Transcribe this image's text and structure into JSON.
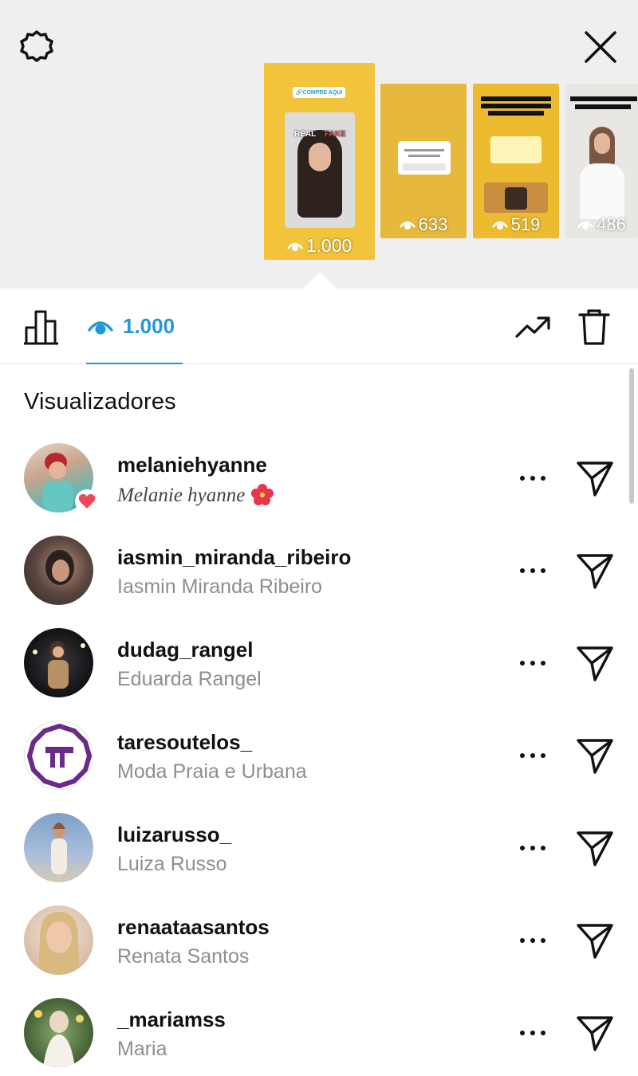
{
  "header": {
    "settings_icon": "gear-icon",
    "close_icon": "close-icon"
  },
  "stories": [
    {
      "views": "1.000",
      "selected": true,
      "tag_text": "COMPRE AQUI",
      "label_left": "REAL",
      "label_right": "FAKE"
    },
    {
      "views": "633",
      "selected": false
    },
    {
      "views": "519",
      "selected": false,
      "title_lines": [
        "Meninas comentem e salvem",
        "porque ainda hoje vou revelar",
        "qual a bolsa Original e",
        "disponibilizar o link da RP",
        "espelhada"
      ],
      "question": "Qual você acha que é a ORIGINAL?"
    },
    {
      "views": "486",
      "selected": false,
      "title_lines": [
        "Quem quer o link vai n",
        "destaques ou manda",
        "DM"
      ]
    }
  ],
  "stats": {
    "views_count": "1.000",
    "chart_icon": "bar-chart-icon",
    "eye_icon": "eye-icon",
    "trend_icon": "trending-up-icon",
    "trash_icon": "trash-icon"
  },
  "viewers_heading": "Visualizadores",
  "viewers": [
    {
      "username": "melaniehyanne",
      "fullname": "Melanie hyanne",
      "liked": true,
      "avatar_color": "#c9a58d"
    },
    {
      "username": "iasmin_miranda_ribeiro",
      "fullname": "Iasmin Miranda Ribeiro",
      "liked": false,
      "avatar_color": "#4d3b36"
    },
    {
      "username": "dudag_rangel",
      "fullname": "Eduarda Rangel",
      "liked": false,
      "avatar_color": "#1c1c1f"
    },
    {
      "username": "taresoutelos_",
      "fullname": "Moda Praia e Urbana",
      "liked": false,
      "avatar_color": "#6a2a8c"
    },
    {
      "username": "luizarusso_",
      "fullname": "Luiza Russo",
      "liked": false,
      "avatar_color": "#8aa7cc"
    },
    {
      "username": "renaataasantos",
      "fullname": "Renata Santos",
      "liked": false,
      "avatar_color": "#dcc3ae"
    },
    {
      "username": "_mariamss",
      "fullname": "Maria",
      "liked": false,
      "avatar_color": "#4c6b3c"
    }
  ],
  "colors": {
    "accent": "#2597d8",
    "background_top": "#efefef",
    "like": "#ed4956"
  }
}
